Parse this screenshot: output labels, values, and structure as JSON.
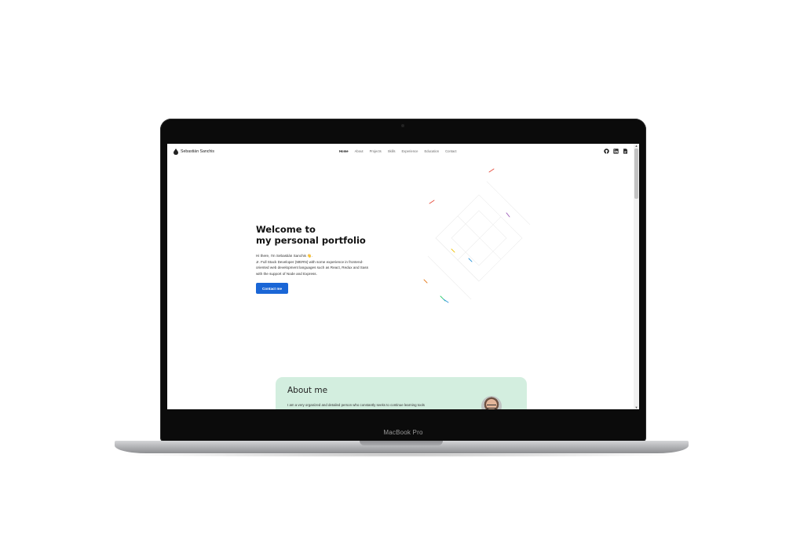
{
  "device": {
    "model_label": "MacBook Pro"
  },
  "nav": {
    "brand": "Sebastián Sanchis",
    "items": [
      "Home",
      "About",
      "Projects",
      "Skills",
      "Experience",
      "Education",
      "Contact"
    ],
    "active": "Home",
    "icons": [
      "github-icon",
      "linkedin-icon",
      "resume-icon"
    ]
  },
  "hero": {
    "title_line1": "Welcome to",
    "title_line2": "my personal portfolio",
    "text_lines": [
      "Hi there, I'm Sebastián Sanchis 👋.",
      "Jr. Full Stack Developer (MERN) with some experience in frontend-",
      "oriented web development languages such as React, Redux and Sass",
      "with the support of Node and Express."
    ],
    "cta_label": "Contact me"
  },
  "about": {
    "title": "About me",
    "text": "I am a very organized and detailed person who constantly seeks to continue learning tools"
  },
  "colors": {
    "accent": "#1a66d6",
    "about_bg": "#d3eedf"
  }
}
